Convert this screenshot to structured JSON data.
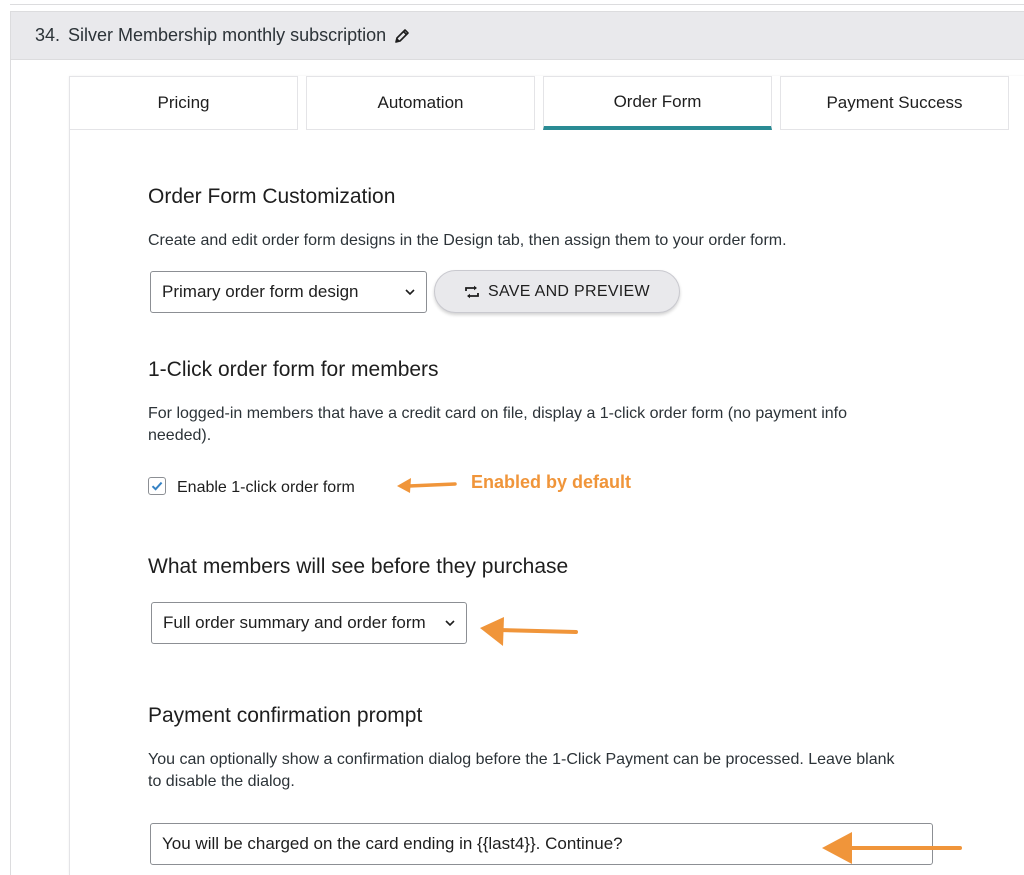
{
  "header": {
    "number": "34.",
    "title": "Silver Membership monthly subscription",
    "edit_icon": "pencil-icon"
  },
  "tabs": [
    {
      "label": "Pricing",
      "active": false
    },
    {
      "label": "Automation",
      "active": false
    },
    {
      "label": "Order Form",
      "active": true
    },
    {
      "label": "Payment Success",
      "active": false
    }
  ],
  "order_form_customization": {
    "heading": "Order Form Customization",
    "description": "Create and edit order form designs in the Design tab, then assign them to your order form.",
    "design_select_value": "Primary order form design",
    "save_button_label": "SAVE AND PREVIEW",
    "save_button_icon": "repeat-icon"
  },
  "one_click": {
    "heading": "1-Click order form for members",
    "description": "For logged-in members that have a credit card on file, display a 1-click order form (no payment info needed).",
    "checkbox_label": "Enable 1-click order form",
    "checked": true,
    "annotation": "Enabled by default"
  },
  "members_see": {
    "heading": "What members will see before they purchase",
    "select_value": "Full order summary and order form"
  },
  "payment_confirmation": {
    "heading": "Payment confirmation prompt",
    "description": "You can optionally show a confirmation dialog before the 1-Click Payment can be processed. Leave blank to disable the dialog.",
    "input_value": "You will be charged on the card ending in {{last4}}. Continue?"
  },
  "colors": {
    "accent_tab": "#2a8b94",
    "annotation_orange": "#f0953a"
  }
}
